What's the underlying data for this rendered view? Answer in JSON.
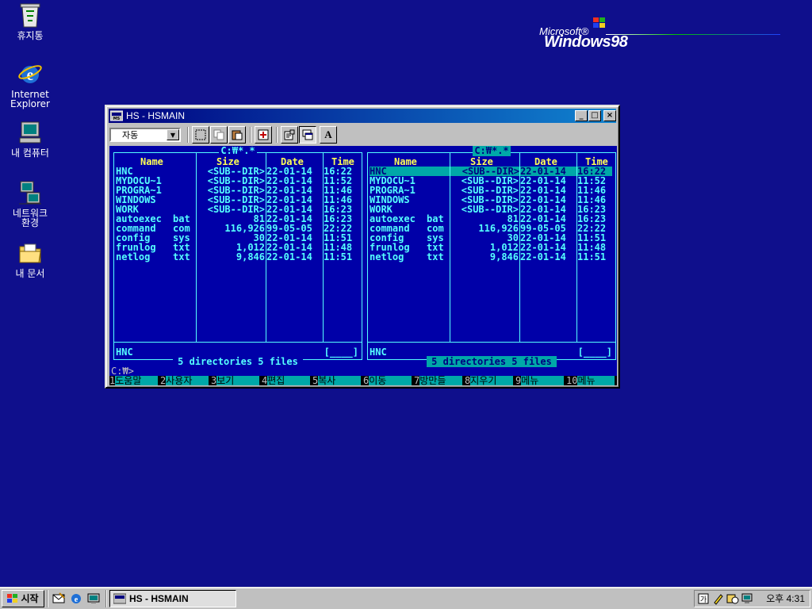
{
  "desktop": {
    "icons": [
      {
        "label": "휴지통",
        "icon": "recycle-bin-icon"
      },
      {
        "label": "Internet\nExplorer",
        "icon": "internet-explorer-icon"
      },
      {
        "label": "내 컴퓨터",
        "icon": "my-computer-icon"
      },
      {
        "label": "네트워크\n환경",
        "icon": "network-neighborhood-icon"
      },
      {
        "label": "내 문서",
        "icon": "my-documents-icon"
      }
    ],
    "logo": {
      "microsoft": "Microsoft®",
      "windows": "Windows98"
    }
  },
  "window": {
    "title": "HS - HSMAIN",
    "controls": {
      "minimize": "_",
      "maximize": "□",
      "close": "×"
    },
    "toolbar": {
      "font_select": "자동",
      "font_button": "A"
    },
    "terminal": {
      "columns": {
        "name": "Name",
        "size": "Size",
        "date": "Date",
        "time": "Time"
      },
      "left_panel": {
        "path": "C:₩*.*",
        "files": [
          {
            "name": "HNC",
            "ext": "",
            "size": "<SUB--DIR>",
            "date": "22-01-14",
            "time": "16:22"
          },
          {
            "name": "MYDOCU~1",
            "ext": "",
            "size": "<SUB--DIR>",
            "date": "22-01-14",
            "time": "11:52"
          },
          {
            "name": "PROGRA~1",
            "ext": "",
            "size": "<SUB--DIR>",
            "date": "22-01-14",
            "time": "11:46"
          },
          {
            "name": "WINDOWS",
            "ext": "",
            "size": "<SUB--DIR>",
            "date": "22-01-14",
            "time": "11:46"
          },
          {
            "name": "WORK",
            "ext": "",
            "size": "<SUB--DIR>",
            "date": "22-01-14",
            "time": "16:23"
          },
          {
            "name": "autoexec",
            "ext": "bat",
            "size": "81",
            "date": "22-01-14",
            "time": "16:23"
          },
          {
            "name": "command",
            "ext": "com",
            "size": "116,926",
            "date": "99-05-05",
            "time": "22:22"
          },
          {
            "name": "config",
            "ext": "sys",
            "size": "30",
            "date": "22-01-14",
            "time": "11:51"
          },
          {
            "name": "frunlog",
            "ext": "txt",
            "size": "1,012",
            "date": "22-01-14",
            "time": "11:48"
          },
          {
            "name": "netlog",
            "ext": "txt",
            "size": "9,846",
            "date": "22-01-14",
            "time": "11:51"
          }
        ],
        "current": "HNC",
        "box": "[____]",
        "summary": "5 directories  5 files"
      },
      "right_panel": {
        "path": "C:₩*.*",
        "files": [
          {
            "name": "HNC",
            "ext": "",
            "size": "<SUB--DIR>",
            "date": "22-01-14",
            "time": "16:22",
            "selected": true
          },
          {
            "name": "MYDOCU~1",
            "ext": "",
            "size": "<SUB--DIR>",
            "date": "22-01-14",
            "time": "11:52"
          },
          {
            "name": "PROGRA~1",
            "ext": "",
            "size": "<SUB--DIR>",
            "date": "22-01-14",
            "time": "11:46"
          },
          {
            "name": "WINDOWS",
            "ext": "",
            "size": "<SUB--DIR>",
            "date": "22-01-14",
            "time": "11:46"
          },
          {
            "name": "WORK",
            "ext": "",
            "size": "<SUB--DIR>",
            "date": "22-01-14",
            "time": "16:23"
          },
          {
            "name": "autoexec",
            "ext": "bat",
            "size": "81",
            "date": "22-01-14",
            "time": "16:23"
          },
          {
            "name": "command",
            "ext": "com",
            "size": "116,926",
            "date": "99-05-05",
            "time": "22:22"
          },
          {
            "name": "config",
            "ext": "sys",
            "size": "30",
            "date": "22-01-14",
            "time": "11:51"
          },
          {
            "name": "frunlog",
            "ext": "txt",
            "size": "1,012",
            "date": "22-01-14",
            "time": "11:48"
          },
          {
            "name": "netlog",
            "ext": "txt",
            "size": "9,846",
            "date": "22-01-14",
            "time": "11:51"
          }
        ],
        "current": "HNC",
        "box": "[____]",
        "summary": "5 directories  5 files"
      },
      "prompt": "C:₩>",
      "function_keys": [
        {
          "num": "1",
          "label": "도움말"
        },
        {
          "num": "2",
          "label": "사용자"
        },
        {
          "num": "3",
          "label": "보기"
        },
        {
          "num": "4",
          "label": "편집"
        },
        {
          "num": "5",
          "label": "복사"
        },
        {
          "num": "6",
          "label": "이동"
        },
        {
          "num": "7",
          "label": "방만들"
        },
        {
          "num": "8",
          "label": "지우기"
        },
        {
          "num": "9",
          "label": "메뉴"
        },
        {
          "num": "10",
          "label": "메뉴"
        }
      ]
    }
  },
  "taskbar": {
    "start_label": "시작",
    "task_label": "HS - HSMAIN",
    "clock": "오후 4:31"
  },
  "colors": {
    "desktop": "#0f0f8c",
    "terminal_bg": "#0000a8",
    "terminal_fg": "#55ffff",
    "header_fg": "#ffff55",
    "highlight": "#00a8a8"
  }
}
